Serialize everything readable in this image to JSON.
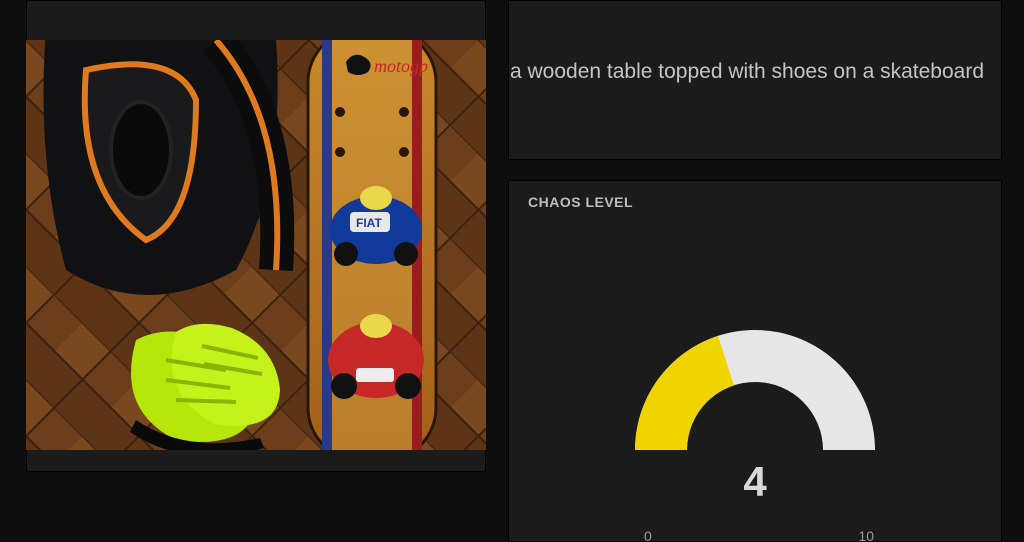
{
  "caption": {
    "text": "a wooden table topped with shoes on a skateboard"
  },
  "gauge": {
    "title": "CHAOS LEVEL",
    "value": 4,
    "min": 0,
    "max": 10,
    "fill_color": "#f0d400",
    "track_color": "#e6e6e6",
    "bg_color": "#2a2a2a"
  },
  "image": {
    "alt": "photo of a backpack, neon green shoes, and a MotoGP skateboard on a wooden parquet floor",
    "skateboard_brand": "motogp"
  },
  "chart_data": {
    "type": "gauge",
    "title": "CHAOS LEVEL",
    "value": 4,
    "range": [
      0,
      10
    ],
    "ticks": [
      0,
      10
    ]
  }
}
